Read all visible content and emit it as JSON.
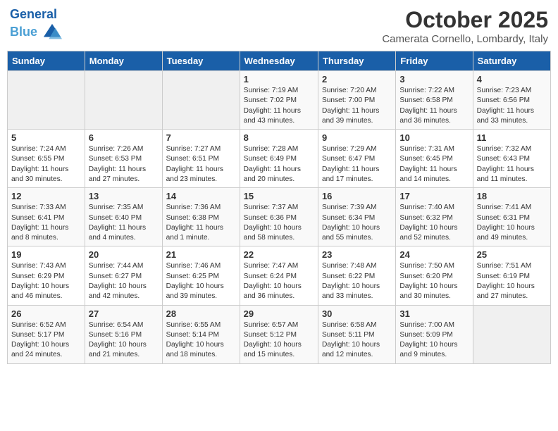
{
  "header": {
    "logo_line1": "General",
    "logo_line2": "Blue",
    "month": "October 2025",
    "location": "Camerata Cornello, Lombardy, Italy"
  },
  "weekdays": [
    "Sunday",
    "Monday",
    "Tuesday",
    "Wednesday",
    "Thursday",
    "Friday",
    "Saturday"
  ],
  "weeks": [
    [
      {
        "day": "",
        "content": ""
      },
      {
        "day": "",
        "content": ""
      },
      {
        "day": "",
        "content": ""
      },
      {
        "day": "1",
        "content": "Sunrise: 7:19 AM\nSunset: 7:02 PM\nDaylight: 11 hours and 43 minutes."
      },
      {
        "day": "2",
        "content": "Sunrise: 7:20 AM\nSunset: 7:00 PM\nDaylight: 11 hours and 39 minutes."
      },
      {
        "day": "3",
        "content": "Sunrise: 7:22 AM\nSunset: 6:58 PM\nDaylight: 11 hours and 36 minutes."
      },
      {
        "day": "4",
        "content": "Sunrise: 7:23 AM\nSunset: 6:56 PM\nDaylight: 11 hours and 33 minutes."
      }
    ],
    [
      {
        "day": "5",
        "content": "Sunrise: 7:24 AM\nSunset: 6:55 PM\nDaylight: 11 hours and 30 minutes."
      },
      {
        "day": "6",
        "content": "Sunrise: 7:26 AM\nSunset: 6:53 PM\nDaylight: 11 hours and 27 minutes."
      },
      {
        "day": "7",
        "content": "Sunrise: 7:27 AM\nSunset: 6:51 PM\nDaylight: 11 hours and 23 minutes."
      },
      {
        "day": "8",
        "content": "Sunrise: 7:28 AM\nSunset: 6:49 PM\nDaylight: 11 hours and 20 minutes."
      },
      {
        "day": "9",
        "content": "Sunrise: 7:29 AM\nSunset: 6:47 PM\nDaylight: 11 hours and 17 minutes."
      },
      {
        "day": "10",
        "content": "Sunrise: 7:31 AM\nSunset: 6:45 PM\nDaylight: 11 hours and 14 minutes."
      },
      {
        "day": "11",
        "content": "Sunrise: 7:32 AM\nSunset: 6:43 PM\nDaylight: 11 hours and 11 minutes."
      }
    ],
    [
      {
        "day": "12",
        "content": "Sunrise: 7:33 AM\nSunset: 6:41 PM\nDaylight: 11 hours and 8 minutes."
      },
      {
        "day": "13",
        "content": "Sunrise: 7:35 AM\nSunset: 6:40 PM\nDaylight: 11 hours and 4 minutes."
      },
      {
        "day": "14",
        "content": "Sunrise: 7:36 AM\nSunset: 6:38 PM\nDaylight: 11 hours and 1 minute."
      },
      {
        "day": "15",
        "content": "Sunrise: 7:37 AM\nSunset: 6:36 PM\nDaylight: 10 hours and 58 minutes."
      },
      {
        "day": "16",
        "content": "Sunrise: 7:39 AM\nSunset: 6:34 PM\nDaylight: 10 hours and 55 minutes."
      },
      {
        "day": "17",
        "content": "Sunrise: 7:40 AM\nSunset: 6:32 PM\nDaylight: 10 hours and 52 minutes."
      },
      {
        "day": "18",
        "content": "Sunrise: 7:41 AM\nSunset: 6:31 PM\nDaylight: 10 hours and 49 minutes."
      }
    ],
    [
      {
        "day": "19",
        "content": "Sunrise: 7:43 AM\nSunset: 6:29 PM\nDaylight: 10 hours and 46 minutes."
      },
      {
        "day": "20",
        "content": "Sunrise: 7:44 AM\nSunset: 6:27 PM\nDaylight: 10 hours and 42 minutes."
      },
      {
        "day": "21",
        "content": "Sunrise: 7:46 AM\nSunset: 6:25 PM\nDaylight: 10 hours and 39 minutes."
      },
      {
        "day": "22",
        "content": "Sunrise: 7:47 AM\nSunset: 6:24 PM\nDaylight: 10 hours and 36 minutes."
      },
      {
        "day": "23",
        "content": "Sunrise: 7:48 AM\nSunset: 6:22 PM\nDaylight: 10 hours and 33 minutes."
      },
      {
        "day": "24",
        "content": "Sunrise: 7:50 AM\nSunset: 6:20 PM\nDaylight: 10 hours and 30 minutes."
      },
      {
        "day": "25",
        "content": "Sunrise: 7:51 AM\nSunset: 6:19 PM\nDaylight: 10 hours and 27 minutes."
      }
    ],
    [
      {
        "day": "26",
        "content": "Sunrise: 6:52 AM\nSunset: 5:17 PM\nDaylight: 10 hours and 24 minutes."
      },
      {
        "day": "27",
        "content": "Sunrise: 6:54 AM\nSunset: 5:16 PM\nDaylight: 10 hours and 21 minutes."
      },
      {
        "day": "28",
        "content": "Sunrise: 6:55 AM\nSunset: 5:14 PM\nDaylight: 10 hours and 18 minutes."
      },
      {
        "day": "29",
        "content": "Sunrise: 6:57 AM\nSunset: 5:12 PM\nDaylight: 10 hours and 15 minutes."
      },
      {
        "day": "30",
        "content": "Sunrise: 6:58 AM\nSunset: 5:11 PM\nDaylight: 10 hours and 12 minutes."
      },
      {
        "day": "31",
        "content": "Sunrise: 7:00 AM\nSunset: 5:09 PM\nDaylight: 10 hours and 9 minutes."
      },
      {
        "day": "",
        "content": ""
      }
    ]
  ]
}
